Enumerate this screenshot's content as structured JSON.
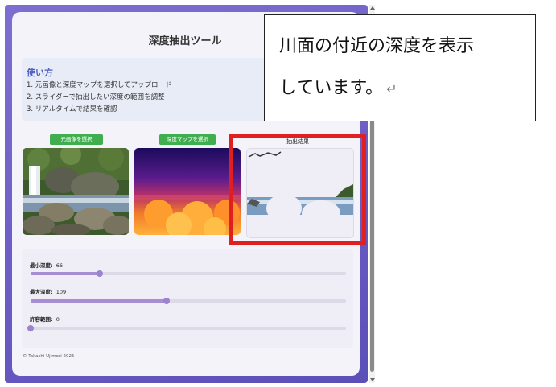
{
  "app": {
    "title": "深度抽出ツール",
    "footer": "© Takashi Ujimori 2025"
  },
  "instructions": {
    "heading": "使い方",
    "steps": [
      "1. 元画像と深度マップを選択してアップロード",
      "2. スライダーで抽出したい深度の範囲を調整",
      "3. リアルタイムで結果を確認"
    ]
  },
  "buttons": {
    "select_original": "元画像を選択",
    "select_depth_map": "深度マップを選択"
  },
  "result": {
    "label": "抽出結果"
  },
  "sliders": {
    "min_depth": {
      "label": "最小深度:",
      "value": "66",
      "level": 0.22
    },
    "max_depth": {
      "label": "最大深度:",
      "value": "109",
      "level": 0.43
    },
    "tolerance": {
      "label": "許容範囲:",
      "value": "0",
      "level": 0.0
    }
  },
  "callout": {
    "line1": "川面の付近の深度を表示",
    "line2": "しています。",
    "return_mark": "↵"
  },
  "colors": {
    "frame_gradient": "#6a5bc4",
    "button_green": "#3fae4f",
    "slider_fill": "#a58fd0",
    "highlight_red": "#e02020"
  }
}
